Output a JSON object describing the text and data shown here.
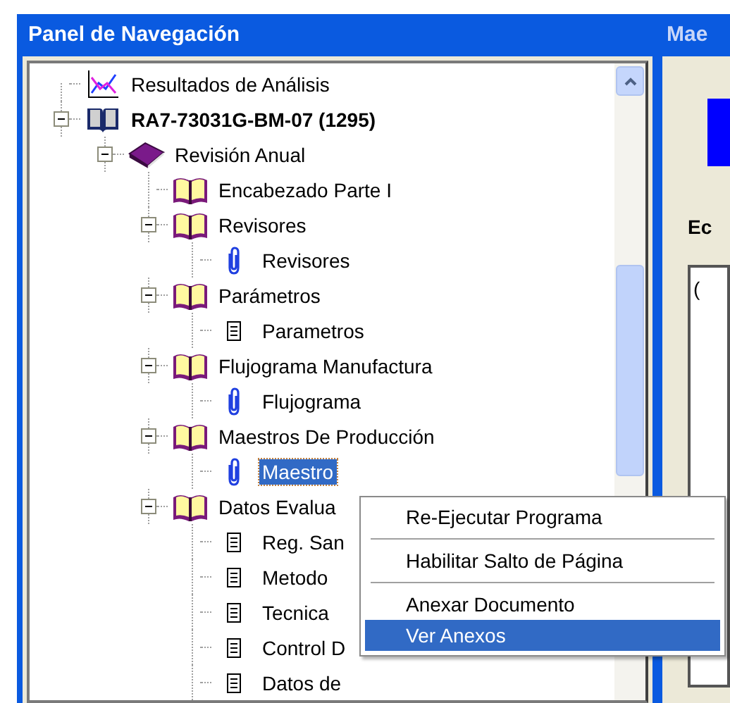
{
  "panel": {
    "title": "Panel de Navegación"
  },
  "tree": [
    {
      "label": "Resultados de Análisis",
      "kind": "chart",
      "selected": false
    },
    {
      "label": "RA7-73031G-BM-07 (1295)",
      "kind": "book",
      "expanded": true,
      "selected": false,
      "children": [
        {
          "label": "Revisión Anual",
          "kind": "volume",
          "expanded": true,
          "selected": false,
          "children": [
            {
              "label": "Encabezado Parte I",
              "kind": "section",
              "selected": false
            },
            {
              "label": "Revisores",
              "kind": "section",
              "expanded": true,
              "selected": false,
              "children": [
                {
                  "label": "Revisores",
                  "kind": "attachment",
                  "selected": false
                }
              ]
            },
            {
              "label": "Parámetros",
              "kind": "section",
              "expanded": true,
              "selected": false,
              "children": [
                {
                  "label": "Parametros",
                  "kind": "document",
                  "selected": false
                }
              ]
            },
            {
              "label": "Flujograma Manufactura",
              "kind": "section",
              "expanded": true,
              "selected": false,
              "children": [
                {
                  "label": "Flujograma",
                  "kind": "attachment",
                  "selected": false
                }
              ]
            },
            {
              "label": "Maestros De Producción",
              "kind": "section",
              "expanded": true,
              "selected": false,
              "children": [
                {
                  "label": "Maestro",
                  "kind": "attachment",
                  "selected": true
                }
              ]
            },
            {
              "label": "Datos Evalua",
              "kind": "section",
              "expanded": true,
              "selected": false,
              "children": [
                {
                  "label": "Reg. San",
                  "kind": "document",
                  "selected": false
                },
                {
                  "label": "Metodo",
                  "kind": "document",
                  "selected": false
                },
                {
                  "label": "Tecnica",
                  "kind": "document",
                  "selected": false
                },
                {
                  "label": "Control D",
                  "kind": "document",
                  "selected": false
                },
                {
                  "label": "Datos de",
                  "kind": "document",
                  "selected": false
                }
              ]
            }
          ]
        }
      ]
    }
  ],
  "context_menu": [
    {
      "kind": "item",
      "label": "Re-Ejecutar Programa",
      "selected": false
    },
    {
      "kind": "separator"
    },
    {
      "kind": "item",
      "label": "Habilitar Salto de Página",
      "selected": false
    },
    {
      "kind": "separator"
    },
    {
      "kind": "item",
      "label": "Anexar Documento",
      "selected": false
    },
    {
      "kind": "item",
      "label": "Ver Anexos",
      "selected": true
    }
  ],
  "side_window": {
    "title": "Mae",
    "heading": "Ec",
    "field_value": "("
  }
}
